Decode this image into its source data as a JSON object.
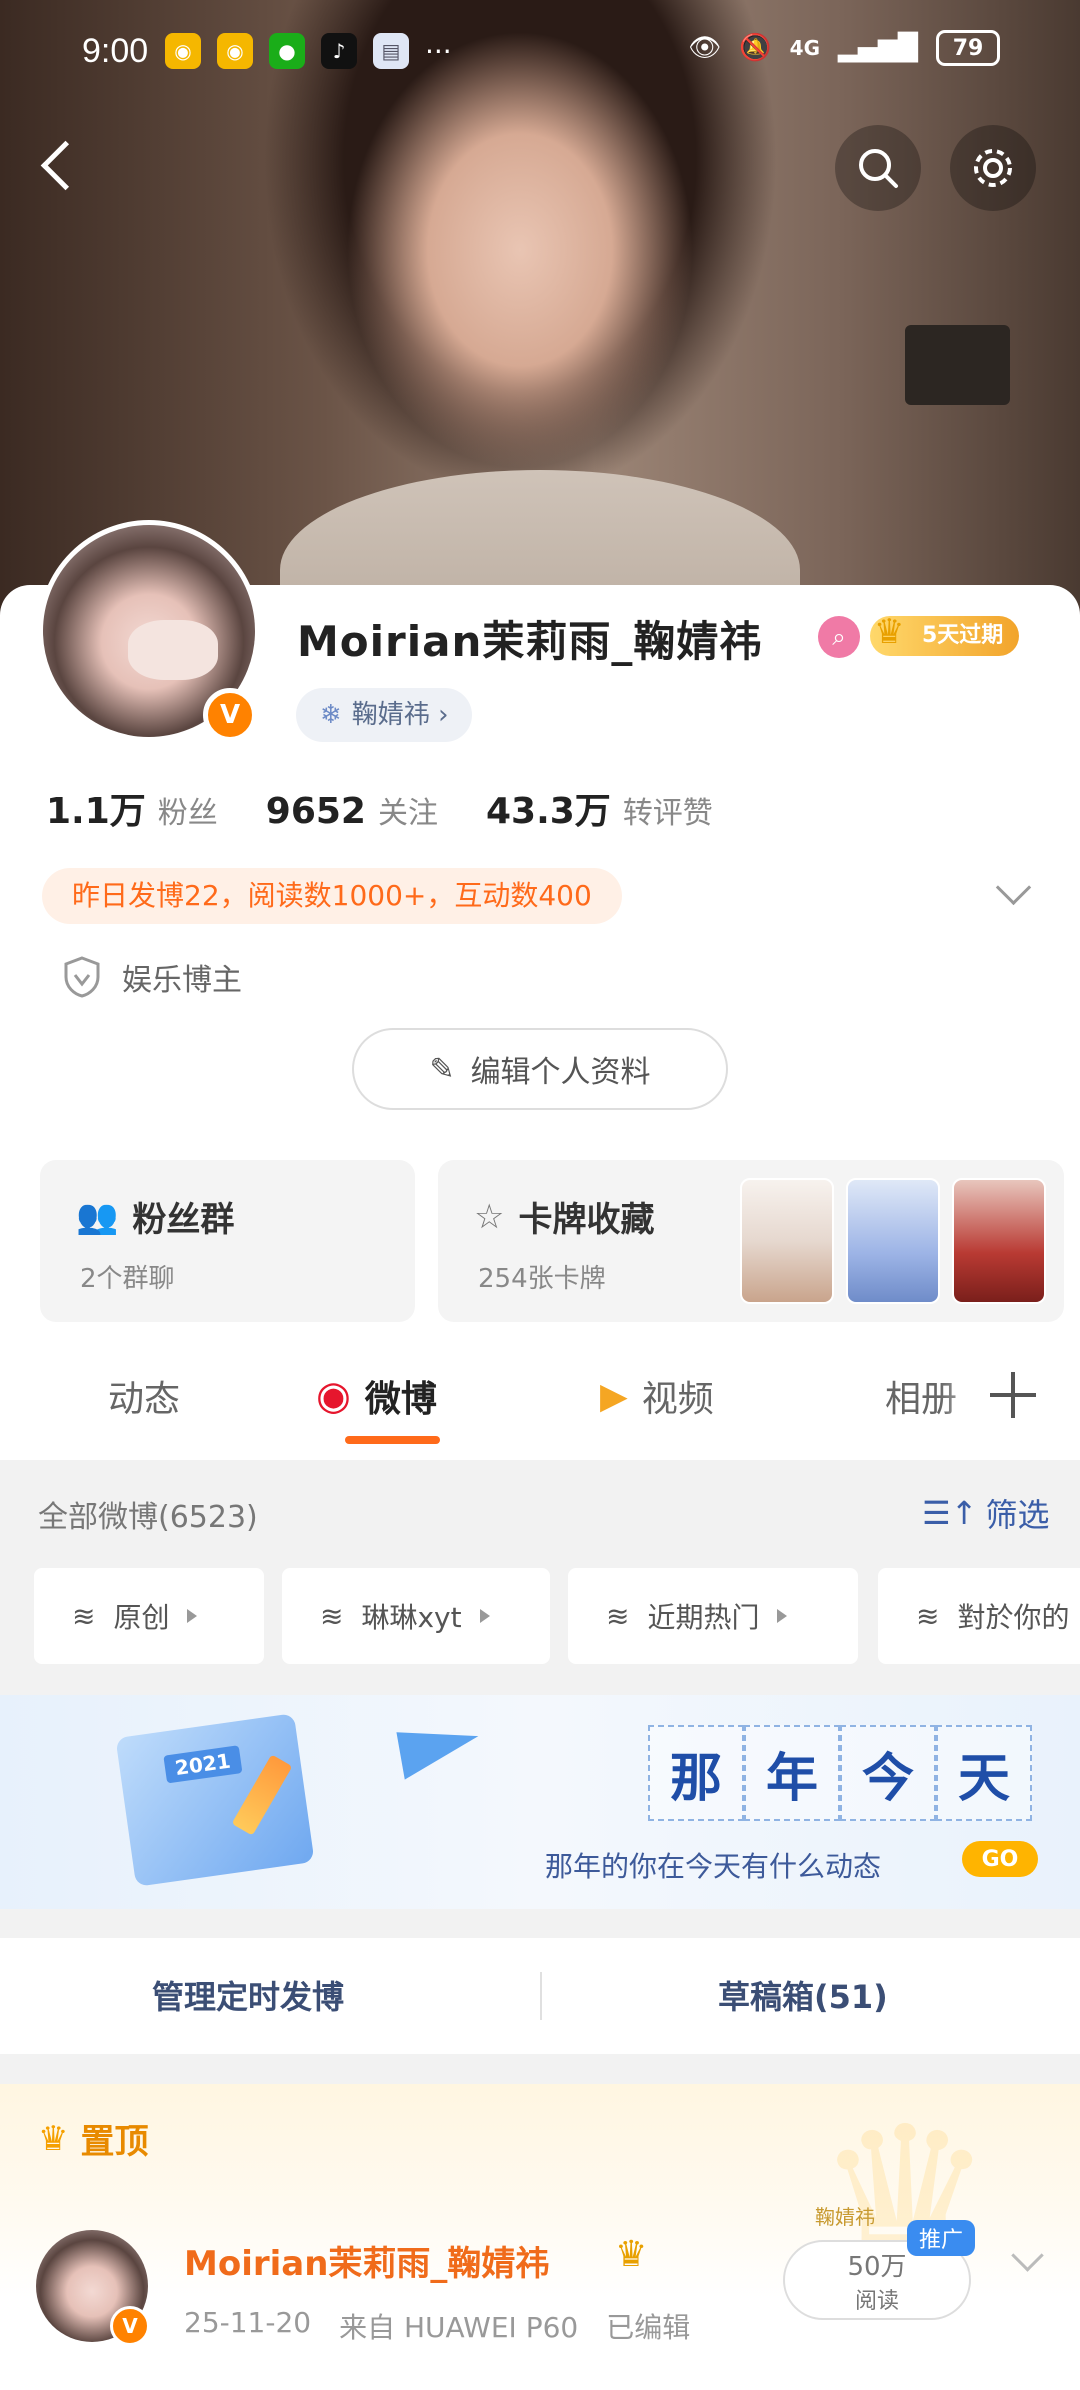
{
  "status_bar": {
    "time": "9:00",
    "network": "4G",
    "battery": "79",
    "more": "···",
    "apps": [
      {
        "icon": "weibo-app-icon",
        "color": "#f5b700"
      },
      {
        "icon": "weibo-app-icon",
        "color": "#f5b700"
      },
      {
        "icon": "wechat-app-icon",
        "color": "#1aad19"
      },
      {
        "icon": "tiktok-app-icon",
        "color": "#111111"
      },
      {
        "icon": "notes-app-icon",
        "color": "#dfe6f5"
      }
    ]
  },
  "profile": {
    "name": "Moirian茉莉雨_鞠婧祎",
    "vip_badge": "5天过期",
    "super_topic": "鞠婧祎",
    "stats": [
      {
        "num": "1.1万",
        "label": "粉丝"
      },
      {
        "num": "9652",
        "label": "关注"
      },
      {
        "num": "43.3万",
        "label": "转评赞"
      }
    ],
    "activity": "昨日发博22，阅读数1000+，互动数400",
    "category": "娱乐博主",
    "edit_button": "编辑个人资料"
  },
  "boxes": {
    "fans_title": "粉丝群",
    "fans_sub": "2个群聊",
    "cards_title": "卡牌收藏",
    "cards_sub": "254张卡牌"
  },
  "tabs": [
    {
      "label": "动态",
      "active": false
    },
    {
      "label": "微博",
      "active": true
    },
    {
      "label": "视频",
      "active": false
    },
    {
      "label": "相册",
      "active": false
    }
  ],
  "feed": {
    "all_count": "全部微博(6523)",
    "filter": "筛选",
    "chips": [
      "原创",
      "琳琳xyt",
      "近期热门",
      "對於你的"
    ]
  },
  "banner": {
    "year": "2021",
    "title_chars": [
      "那",
      "年",
      "今",
      "天"
    ],
    "subtitle": "那年的你在今天有什么动态",
    "go": "GO"
  },
  "manage": {
    "scheduled": "管理定时发博",
    "drafts": "草稿箱(51)"
  },
  "pinned": {
    "label": "置顶",
    "name": "Moirian茉莉雨_鞠婧祎",
    "date": "25-11-20",
    "source": "来自 HUAWEI P60",
    "edited": "已编辑",
    "ad_tag": "鞠婧祎",
    "promo_value": "50万",
    "promo_unit": "阅读",
    "promo_badge": "推广"
  },
  "colors": {
    "accent": "#ff6a1a",
    "brand_blue": "#3b5ea8",
    "vip_gold": "#f2a42b"
  }
}
